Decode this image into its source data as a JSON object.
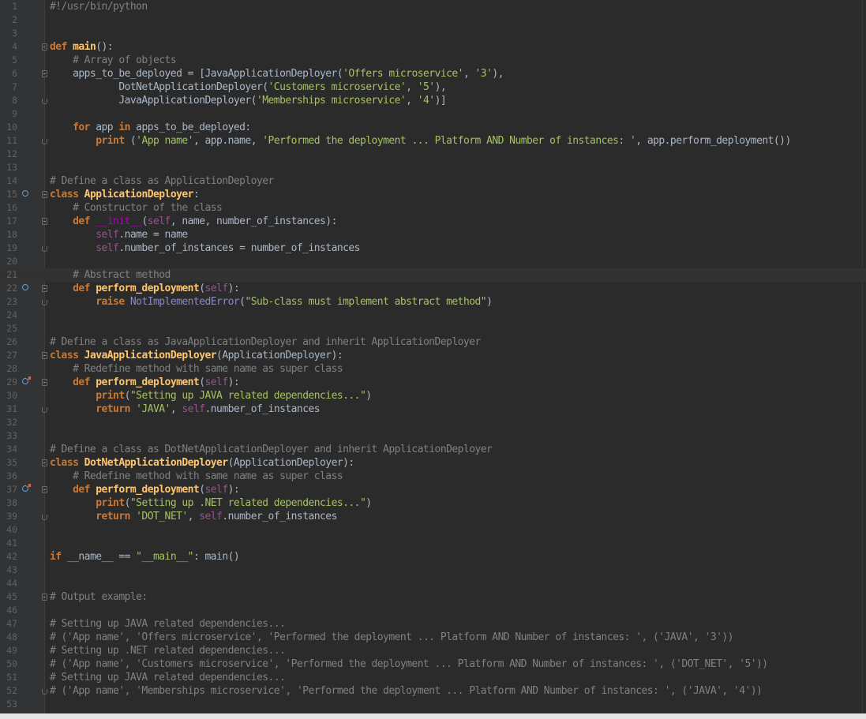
{
  "editor": {
    "language": "python",
    "colors": {
      "background": "#2b2b2b",
      "gutter": "#313335",
      "keyword": "#cc7832",
      "function": "#ffc66d",
      "string": "#a5c261",
      "comment": "#808080",
      "self": "#94558d",
      "builtin": "#8888c6",
      "text": "#a9b7c6"
    },
    "current_line": 21,
    "gutter_markers": {
      "15": "override-marker",
      "22": "override-marker",
      "29": "implements-marker",
      "37": "implements-marker"
    },
    "lines": [
      {
        "n": "1",
        "tokens": [
          {
            "t": "#!/usr/bin/python",
            "c": "cm"
          }
        ]
      },
      {
        "n": "2",
        "tokens": []
      },
      {
        "n": "3",
        "tokens": []
      },
      {
        "n": "4",
        "fold": "open",
        "tokens": [
          {
            "t": "def ",
            "c": "kw"
          },
          {
            "t": "main",
            "c": "fn"
          },
          {
            "t": "():",
            "c": ""
          }
        ]
      },
      {
        "n": "5",
        "tokens": [
          {
            "t": "    # Array of objects",
            "c": "cm"
          }
        ]
      },
      {
        "n": "6",
        "fold": "open",
        "tokens": [
          {
            "t": "    apps_to_be_deployed = [JavaApplicationDeployer(",
            "c": ""
          },
          {
            "t": "'Offers microservice'",
            "c": "str"
          },
          {
            "t": ", ",
            "c": ""
          },
          {
            "t": "'3'",
            "c": "str"
          },
          {
            "t": "),",
            "c": ""
          }
        ]
      },
      {
        "n": "7",
        "tokens": [
          {
            "t": "            DotNetApplicationDeployer(",
            "c": ""
          },
          {
            "t": "'Customers microservice'",
            "c": "str"
          },
          {
            "t": ", ",
            "c": ""
          },
          {
            "t": "'5'",
            "c": "str"
          },
          {
            "t": "),",
            "c": ""
          }
        ]
      },
      {
        "n": "8",
        "fold": "end",
        "tokens": [
          {
            "t": "            JavaApplicationDeployer(",
            "c": ""
          },
          {
            "t": "'Memberships microservice'",
            "c": "str"
          },
          {
            "t": ", ",
            "c": ""
          },
          {
            "t": "'4'",
            "c": "str"
          },
          {
            "t": ")]",
            "c": ""
          }
        ]
      },
      {
        "n": "9",
        "tokens": []
      },
      {
        "n": "10",
        "tokens": [
          {
            "t": "    ",
            "c": ""
          },
          {
            "t": "for ",
            "c": "kw"
          },
          {
            "t": "app ",
            "c": ""
          },
          {
            "t": "in ",
            "c": "kw"
          },
          {
            "t": "apps_to_be_deployed:",
            "c": ""
          }
        ]
      },
      {
        "n": "11",
        "fold": "end",
        "tokens": [
          {
            "t": "        ",
            "c": ""
          },
          {
            "t": "print ",
            "c": "kw"
          },
          {
            "t": "(",
            "c": ""
          },
          {
            "t": "'App name'",
            "c": "str"
          },
          {
            "t": ", app.name, ",
            "c": ""
          },
          {
            "t": "'Performed the deployment ... Platform AND Number of instances: '",
            "c": "str"
          },
          {
            "t": ", app.perform_deployment())",
            "c": ""
          }
        ]
      },
      {
        "n": "12",
        "tokens": []
      },
      {
        "n": "13",
        "tokens": []
      },
      {
        "n": "14",
        "tokens": [
          {
            "t": "# Define a class as ApplicationDeployer",
            "c": "cm"
          }
        ]
      },
      {
        "n": "15",
        "fold": "open",
        "tokens": [
          {
            "t": "class ",
            "c": "kw"
          },
          {
            "t": "ApplicationDeployer",
            "c": "fn"
          },
          {
            "t": ":",
            "c": ""
          }
        ]
      },
      {
        "n": "16",
        "tokens": [
          {
            "t": "    # Constructor of the class",
            "c": "cm"
          }
        ]
      },
      {
        "n": "17",
        "fold": "open",
        "tokens": [
          {
            "t": "    ",
            "c": ""
          },
          {
            "t": "def ",
            "c": "kw"
          },
          {
            "t": "__init__",
            "c": "mg"
          },
          {
            "t": "(",
            "c": ""
          },
          {
            "t": "self",
            "c": "sf"
          },
          {
            "t": ", name, number_of_instances):",
            "c": ""
          }
        ]
      },
      {
        "n": "18",
        "tokens": [
          {
            "t": "        ",
            "c": ""
          },
          {
            "t": "self",
            "c": "sf"
          },
          {
            "t": ".name = name",
            "c": ""
          }
        ]
      },
      {
        "n": "19",
        "fold": "end",
        "tokens": [
          {
            "t": "        ",
            "c": ""
          },
          {
            "t": "self",
            "c": "sf"
          },
          {
            "t": ".number_of_instances = number_of_instances",
            "c": ""
          }
        ]
      },
      {
        "n": "20",
        "tokens": []
      },
      {
        "n": "21",
        "tokens": [
          {
            "t": "    # Abstract method",
            "c": "cm"
          }
        ]
      },
      {
        "n": "22",
        "fold": "open",
        "tokens": [
          {
            "t": "    ",
            "c": ""
          },
          {
            "t": "def ",
            "c": "kw"
          },
          {
            "t": "perform_deployment",
            "c": "fn"
          },
          {
            "t": "(",
            "c": ""
          },
          {
            "t": "self",
            "c": "sf"
          },
          {
            "t": "):",
            "c": ""
          }
        ]
      },
      {
        "n": "23",
        "fold": "end",
        "tokens": [
          {
            "t": "        ",
            "c": ""
          },
          {
            "t": "raise ",
            "c": "kw"
          },
          {
            "t": "NotImplementedError",
            "c": "bi"
          },
          {
            "t": "(",
            "c": ""
          },
          {
            "t": "\"Sub-class must implement abstract method\"",
            "c": "str"
          },
          {
            "t": ")",
            "c": ""
          }
        ]
      },
      {
        "n": "24",
        "tokens": []
      },
      {
        "n": "25",
        "tokens": []
      },
      {
        "n": "26",
        "tokens": [
          {
            "t": "# Define a class as JavaApplicationDeployer and inherit ApplicationDeployer",
            "c": "cm"
          }
        ]
      },
      {
        "n": "27",
        "fold": "open",
        "tokens": [
          {
            "t": "class ",
            "c": "kw"
          },
          {
            "t": "JavaApplicationDeployer",
            "c": "fn"
          },
          {
            "t": "(ApplicationDeployer):",
            "c": ""
          }
        ]
      },
      {
        "n": "28",
        "tokens": [
          {
            "t": "    # Redefine method with same name as super class",
            "c": "cm"
          }
        ]
      },
      {
        "n": "29",
        "fold": "open",
        "tokens": [
          {
            "t": "    ",
            "c": ""
          },
          {
            "t": "def ",
            "c": "kw"
          },
          {
            "t": "perform_deployment",
            "c": "fn"
          },
          {
            "t": "(",
            "c": ""
          },
          {
            "t": "self",
            "c": "sf"
          },
          {
            "t": "):",
            "c": ""
          }
        ]
      },
      {
        "n": "30",
        "tokens": [
          {
            "t": "        ",
            "c": ""
          },
          {
            "t": "print",
            "c": "kw"
          },
          {
            "t": "(",
            "c": ""
          },
          {
            "t": "\"Setting up JAVA related dependencies...\"",
            "c": "str"
          },
          {
            "t": ")",
            "c": ""
          }
        ]
      },
      {
        "n": "31",
        "fold": "end",
        "tokens": [
          {
            "t": "        ",
            "c": ""
          },
          {
            "t": "return ",
            "c": "kw"
          },
          {
            "t": "'JAVA'",
            "c": "str"
          },
          {
            "t": ", ",
            "c": ""
          },
          {
            "t": "self",
            "c": "sf"
          },
          {
            "t": ".number_of_instances",
            "c": ""
          }
        ]
      },
      {
        "n": "32",
        "tokens": []
      },
      {
        "n": "33",
        "tokens": []
      },
      {
        "n": "34",
        "tokens": [
          {
            "t": "# Define a class as DotNetApplicationDeployer and inherit ApplicationDeployer",
            "c": "cm"
          }
        ]
      },
      {
        "n": "35",
        "fold": "open",
        "tokens": [
          {
            "t": "class ",
            "c": "kw"
          },
          {
            "t": "DotNetApplicationDeployer",
            "c": "fn"
          },
          {
            "t": "(ApplicationDeployer):",
            "c": ""
          }
        ]
      },
      {
        "n": "36",
        "tokens": [
          {
            "t": "    # Redefine method with same name as super class",
            "c": "cm"
          }
        ]
      },
      {
        "n": "37",
        "fold": "open",
        "tokens": [
          {
            "t": "    ",
            "c": ""
          },
          {
            "t": "def ",
            "c": "kw"
          },
          {
            "t": "perform_deployment",
            "c": "fn"
          },
          {
            "t": "(",
            "c": ""
          },
          {
            "t": "self",
            "c": "sf"
          },
          {
            "t": "):",
            "c": ""
          }
        ]
      },
      {
        "n": "38",
        "tokens": [
          {
            "t": "        ",
            "c": ""
          },
          {
            "t": "print",
            "c": "kw"
          },
          {
            "t": "(",
            "c": ""
          },
          {
            "t": "\"Setting up .NET related dependencies...\"",
            "c": "str"
          },
          {
            "t": ")",
            "c": ""
          }
        ]
      },
      {
        "n": "39",
        "fold": "end",
        "tokens": [
          {
            "t": "        ",
            "c": ""
          },
          {
            "t": "return ",
            "c": "kw"
          },
          {
            "t": "'DOT_NET'",
            "c": "str"
          },
          {
            "t": ", ",
            "c": ""
          },
          {
            "t": "self",
            "c": "sf"
          },
          {
            "t": ".number_of_instances",
            "c": ""
          }
        ]
      },
      {
        "n": "40",
        "tokens": []
      },
      {
        "n": "41",
        "tokens": []
      },
      {
        "n": "42",
        "tokens": [
          {
            "t": "if ",
            "c": "kw"
          },
          {
            "t": "__name__ == ",
            "c": ""
          },
          {
            "t": "\"__main__\"",
            "c": "str"
          },
          {
            "t": ": main()",
            "c": ""
          }
        ]
      },
      {
        "n": "43",
        "tokens": []
      },
      {
        "n": "44",
        "tokens": []
      },
      {
        "n": "45",
        "fold": "open",
        "tokens": [
          {
            "t": "# Output example:",
            "c": "cm"
          }
        ]
      },
      {
        "n": "46",
        "tokens": []
      },
      {
        "n": "47",
        "tokens": [
          {
            "t": "# Setting up JAVA related dependencies...",
            "c": "cm"
          }
        ]
      },
      {
        "n": "48",
        "tokens": [
          {
            "t": "# ('App name', 'Offers microservice', 'Performed the deployment ... Platform AND Number of instances: ', ('JAVA', '3'))",
            "c": "cm"
          }
        ]
      },
      {
        "n": "49",
        "tokens": [
          {
            "t": "# Setting up .NET related dependencies...",
            "c": "cm"
          }
        ]
      },
      {
        "n": "50",
        "tokens": [
          {
            "t": "# ('App name', 'Customers microservice', 'Performed the deployment ... Platform AND Number of instances: ', ('DOT_NET', '5'))",
            "c": "cm"
          }
        ]
      },
      {
        "n": "51",
        "tokens": [
          {
            "t": "# Setting up JAVA related dependencies...",
            "c": "cm"
          }
        ]
      },
      {
        "n": "52",
        "fold": "end",
        "tokens": [
          {
            "t": "# ('App name', 'Memberships microservice', 'Performed the deployment ... Platform AND Number of instances: ', ('JAVA', '4'))",
            "c": "cm"
          }
        ]
      },
      {
        "n": "53",
        "tokens": []
      }
    ]
  }
}
